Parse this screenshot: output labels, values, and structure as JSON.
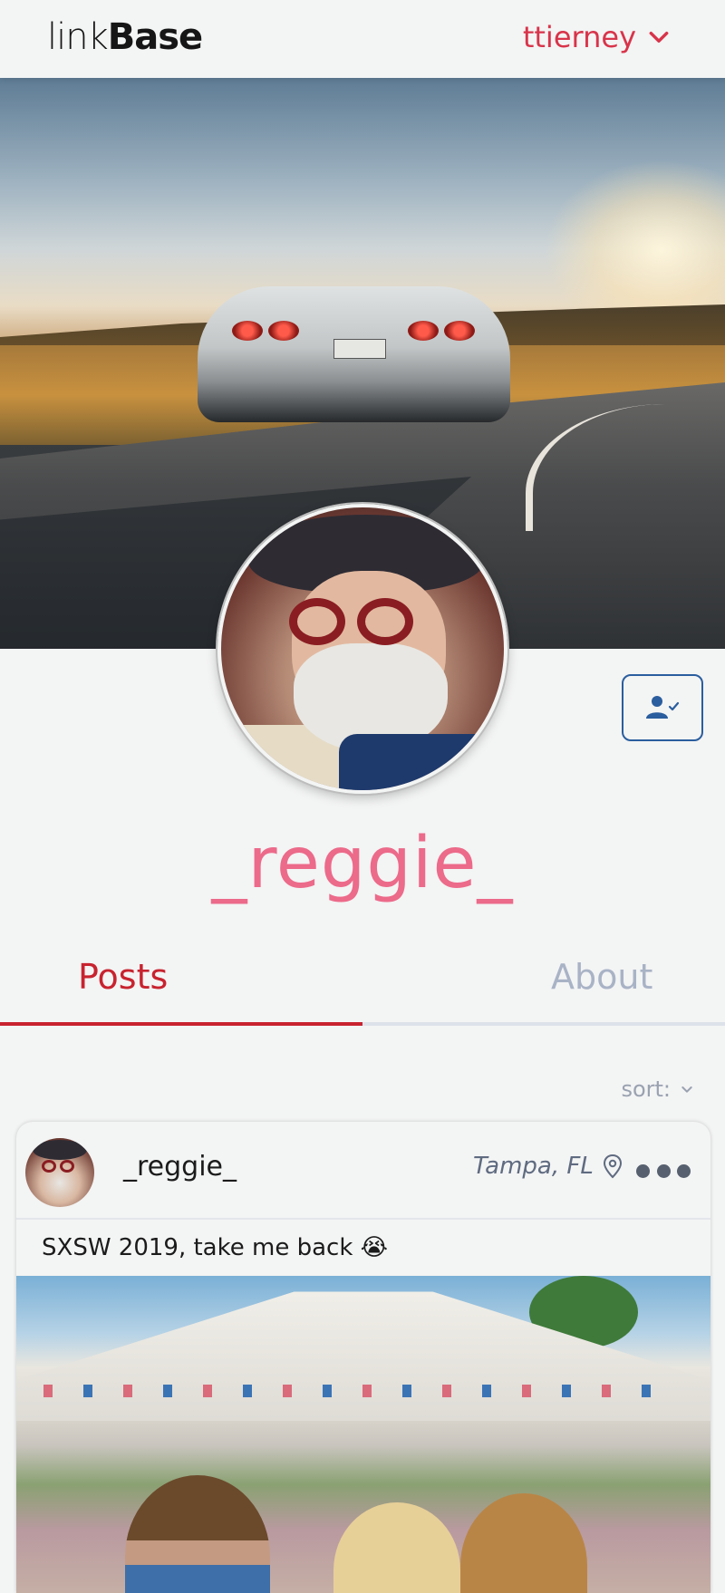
{
  "header": {
    "logo_light": "link",
    "logo_bold": "Base",
    "current_user": "ttierney",
    "accent_color": "#d8344a"
  },
  "profile": {
    "username": "_reggie_",
    "username_color": "#ec6a8a",
    "follow_icon": "user-check-icon"
  },
  "tabs": [
    {
      "label": "Posts",
      "active": true
    },
    {
      "label": "About",
      "active": false
    }
  ],
  "sort": {
    "label": "sort:"
  },
  "post": {
    "username": "_reggie_",
    "location": "Tampa, FL",
    "caption": "SXSW 2019, take me back 😭",
    "more_icon": "more-horizontal-icon"
  }
}
